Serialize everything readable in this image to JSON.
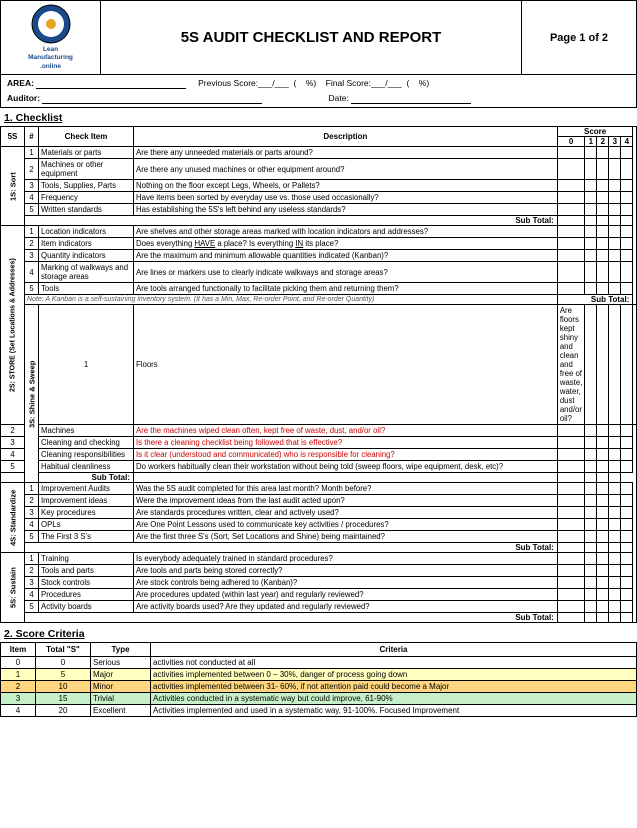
{
  "header": {
    "title": "5S AUDIT CHECKLIST AND REPORT",
    "page": "Page 1 of 2",
    "logo_line1": "Lean",
    "logo_line2": "Manufacturing",
    "logo_line3": ".online"
  },
  "info": {
    "area_label": "AREA:",
    "prev_score_label": "Previous Score:",
    "pct_label": "(%)",
    "final_score_label": "Final Score:",
    "auditor_label": "Auditor:",
    "date_label": "Date:"
  },
  "checklist_title": "1. Checklist",
  "table_headers": {
    "col_5s": "5S",
    "col_num": "#",
    "col_check": "Check Item",
    "col_desc": "Description",
    "col_score": "Score",
    "score_sub0": "0",
    "score_sub1": "1",
    "score_sub2": "2",
    "score_sub3": "3",
    "score_sub4": "4"
  },
  "s1": {
    "label": "1S: Sort",
    "items": [
      {
        "num": "1",
        "check": "Materials or parts",
        "desc": "Are there any unneeded materials or parts around?",
        "red": false
      },
      {
        "num": "2",
        "check": "Machines or other equipment",
        "desc": "Are there any unused machines or other equipment around?",
        "red": false
      },
      {
        "num": "3",
        "check": "Tools, Supplies, Parts",
        "desc": "Nothing on the floor except Legs, Wheels, or Pallets?",
        "red": false
      },
      {
        "num": "4",
        "check": "Frequency",
        "desc": "Have items been sorted by everyday use vs. those used occasionally?",
        "red": false
      },
      {
        "num": "5",
        "check": "Written standards",
        "desc": "Has establishing the 5S's left behind any useless standards?",
        "red": false
      }
    ],
    "subtotal": "Sub Total:"
  },
  "s2": {
    "label": "2S: STORE (Set Locations & Addresses)",
    "items": [
      {
        "num": "1",
        "check": "Location indicators",
        "desc": "Are shelves and other storage areas marked with location indicators and addresses?",
        "red": false
      },
      {
        "num": "2",
        "check": "Item indicators",
        "desc": "Does everything HAVE a place?  Is everything IN its place?",
        "red": false
      },
      {
        "num": "3",
        "check": "Quantity indicators",
        "desc": "Are the maximum and minimum allowable quantities indicated (Kanban)?",
        "red": false
      },
      {
        "num": "4",
        "check": "Marking of walkways and storage areas",
        "desc": "Are lines or markers use to clearly indicate walkways and storage areas?",
        "red": false
      },
      {
        "num": "5",
        "check": "Tools",
        "desc": "Are tools arranged functionally to facilitate picking them and returning them?",
        "red": false
      }
    ],
    "note": "Note: A Kanban is a self-sustaining inventory system. (It has a Min, Max, Re-order Point, and Re-order Quantity)",
    "subtotal": "Sub Total:"
  },
  "s3": {
    "label": "3S: Shine & Sweep",
    "items": [
      {
        "num": "1",
        "check": "Floors",
        "desc": "Are floors kept shiny and clean and free of waste, water, dust and/or oil?",
        "red": false
      },
      {
        "num": "2",
        "check": "Machines",
        "desc": "Are the machines wiped clean often, kept free of waste, dust, and/or oil?",
        "red": true
      },
      {
        "num": "3",
        "check": "Cleaning and checking",
        "desc": "Is there a cleaning checklist being followed that is effective?",
        "red": true
      },
      {
        "num": "4",
        "check": "Cleaning responsibilities",
        "desc": "Is it clear (understood and communicated) who is responsible for cleaning?",
        "red": true
      },
      {
        "num": "5",
        "check": "Habitual cleanliness",
        "desc": "Do workers habitually clean their workstation without being told (sweep floors, wipe equipment, desk, etc)?",
        "red": false
      }
    ],
    "subtotal": "Sub Total:"
  },
  "s4": {
    "label": "4S: Standardize",
    "items": [
      {
        "num": "1",
        "check": "Improvement Audits",
        "desc": "Was the 5S audit completed for this area last month? Month before?",
        "red": false
      },
      {
        "num": "2",
        "check": "Improvement ideas",
        "desc": "Were the improvement ideas from the last audit acted upon?",
        "red": false
      },
      {
        "num": "3",
        "check": "Key procedures",
        "desc": "Are standards procedures written, clear and actively used?",
        "red": false
      },
      {
        "num": "4",
        "check": "OPLs",
        "desc": "Are One Point Lessons used to communicate key activities / procedures?",
        "red": false
      },
      {
        "num": "5",
        "check": "The First 3 S's",
        "desc": "Are the first three S's (Sort, Set Locations and Shine) being maintained?",
        "red": false
      }
    ],
    "subtotal": "Sub Total:"
  },
  "s5": {
    "label": "5S: Sustain",
    "items": [
      {
        "num": "1",
        "check": "Training",
        "desc": "Is everybody adequately trained in standard procedures?",
        "red": false
      },
      {
        "num": "2",
        "check": "Tools and parts",
        "desc": "Are tools and parts being stored correctly?",
        "red": false
      },
      {
        "num": "3",
        "check": "Stock controls",
        "desc": "Are stock controls being adhered to (Kanban)?",
        "red": false
      },
      {
        "num": "4",
        "check": "Procedures",
        "desc": "Are procedures updated (within last year) and regularly reviewed?",
        "red": false
      },
      {
        "num": "5",
        "check": "Activity boards",
        "desc": "Are activity boards used?  Are they updated and regularly reviewed?",
        "red": false
      }
    ],
    "subtotal": "Sub Total:"
  },
  "score_criteria_title": "2. Score Criteria",
  "criteria_headers": {
    "item": "Item",
    "total_s": "Total \"S\"",
    "type": "Type",
    "criteria": "Criteria"
  },
  "criteria_rows": [
    {
      "item": "0",
      "total": "0",
      "type": "Serious",
      "criteria": "activities not conducted at all",
      "color": "none"
    },
    {
      "item": "1",
      "total": "5",
      "type": "Major",
      "criteria": "activities implemented between 0 – 30%, danger of process going down",
      "color": "yellow"
    },
    {
      "item": "2",
      "total": "10",
      "type": "Minor",
      "criteria": "activities implemented between 31- 60%, if not attention paid could become a Major",
      "color": "orange"
    },
    {
      "item": "3",
      "total": "15",
      "type": "Trivial",
      "criteria": "Activities conducted in a systematic way but could improve, 61-90%",
      "color": "green"
    },
    {
      "item": "4",
      "total": "20",
      "type": "Excellent",
      "criteria": "Activities implemented and used in a systematic way, 91-100%. Focused Improvement",
      "color": "none"
    }
  ]
}
